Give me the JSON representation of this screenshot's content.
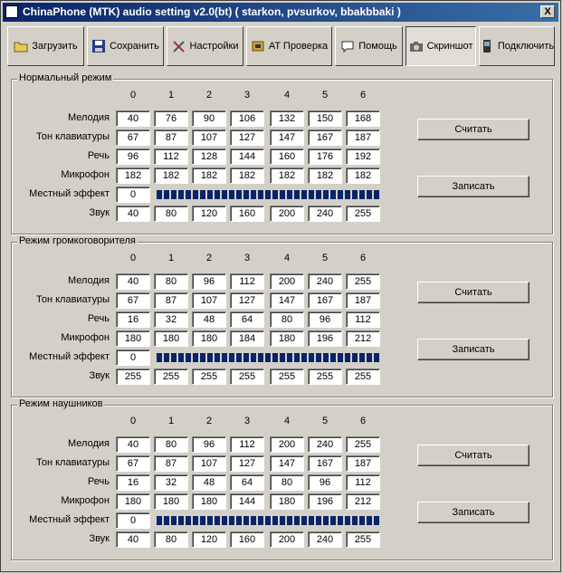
{
  "window": {
    "title": "ChinaPhone (MTK) audio setting v2.0(bt) ( starkon, pvsurkov, bbakbbaki )",
    "close_label": "X"
  },
  "toolbar": {
    "load": "Загрузить",
    "save": "Сохранить",
    "settings": "Настройки",
    "at_check": "AT Проверка",
    "help": "Помощь",
    "screenshot": "Скриншот",
    "connect": "Подключить"
  },
  "columns": [
    "0",
    "1",
    "2",
    "3",
    "4",
    "5",
    "6"
  ],
  "row_labels": [
    "Мелодия",
    "Тон клавиатуры",
    "Речь",
    "Микрофон",
    "Местный эффект",
    "Звук"
  ],
  "buttons": {
    "read": "Считать",
    "write": "Записать"
  },
  "modes": [
    {
      "title": "Нормальный режим",
      "melody": [
        "40",
        "76",
        "90",
        "106",
        "132",
        "150",
        "168"
      ],
      "keytone": [
        "67",
        "87",
        "107",
        "127",
        "147",
        "167",
        "187"
      ],
      "speech": [
        "96",
        "112",
        "128",
        "144",
        "160",
        "176",
        "192"
      ],
      "mic": [
        "182",
        "182",
        "182",
        "182",
        "182",
        "182",
        "182"
      ],
      "sidetone": "0",
      "sound": [
        "40",
        "80",
        "120",
        "160",
        "200",
        "240",
        "255"
      ]
    },
    {
      "title": "Режим громкоговорителя",
      "melody": [
        "40",
        "80",
        "96",
        "112",
        "200",
        "240",
        "255"
      ],
      "keytone": [
        "67",
        "87",
        "107",
        "127",
        "147",
        "167",
        "187"
      ],
      "speech": [
        "16",
        "32",
        "48",
        "64",
        "80",
        "96",
        "112"
      ],
      "mic": [
        "180",
        "180",
        "180",
        "184",
        "180",
        "196",
        "212"
      ],
      "sidetone": "0",
      "sound": [
        "255",
        "255",
        "255",
        "255",
        "255",
        "255",
        "255"
      ]
    },
    {
      "title": "Режим наушников",
      "melody": [
        "40",
        "80",
        "96",
        "112",
        "200",
        "240",
        "255"
      ],
      "keytone": [
        "67",
        "87",
        "107",
        "127",
        "147",
        "167",
        "187"
      ],
      "speech": [
        "16",
        "32",
        "48",
        "64",
        "80",
        "96",
        "112"
      ],
      "mic": [
        "180",
        "180",
        "180",
        "144",
        "180",
        "196",
        "212"
      ],
      "sidetone": "0",
      "sound": [
        "40",
        "80",
        "120",
        "160",
        "200",
        "240",
        "255"
      ]
    }
  ],
  "icons": [
    "folder-icon",
    "floppy-icon",
    "tools-icon",
    "chip-icon",
    "speech-bubble-icon",
    "camera-icon",
    "phone-icon"
  ]
}
